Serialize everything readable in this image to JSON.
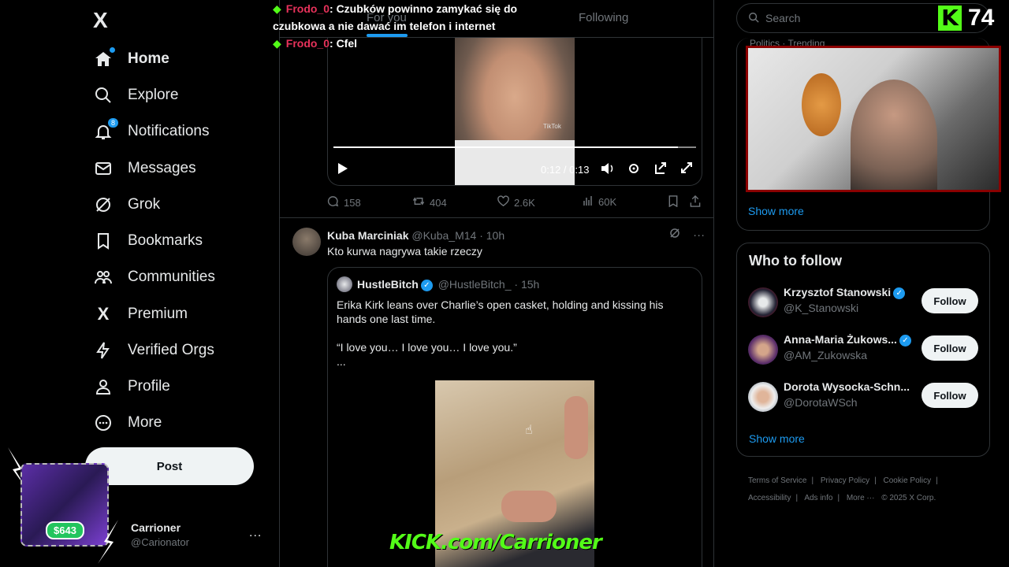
{
  "sidebar": {
    "logo": "X",
    "items": [
      {
        "label": "Home",
        "icon": "home-icon"
      },
      {
        "label": "Explore",
        "icon": "search-icon"
      },
      {
        "label": "Notifications",
        "icon": "bell-icon",
        "badge": "8"
      },
      {
        "label": "Messages",
        "icon": "mail-icon"
      },
      {
        "label": "Grok",
        "icon": "grok-icon"
      },
      {
        "label": "Bookmarks",
        "icon": "bookmark-icon"
      },
      {
        "label": "Communities",
        "icon": "people-icon"
      },
      {
        "label": "Premium",
        "icon": "x-icon"
      },
      {
        "label": "Verified Orgs",
        "icon": "lightning-icon"
      },
      {
        "label": "Profile",
        "icon": "person-icon"
      },
      {
        "label": "More",
        "icon": "more-circle-icon"
      }
    ],
    "post_label": "Post",
    "account": {
      "name": "Carrioner",
      "handle": "@Carionator",
      "more": "..."
    }
  },
  "overlay": {
    "donation": "$643",
    "chat": [
      {
        "user": "Frodo_0",
        "text": ": Czubków powinno zamykać się do czubkowa a nie dawać im telefon i internet"
      },
      {
        "user": "Frodo_0",
        "text": ": Cfel"
      }
    ],
    "kick_url": "KICK.com/Carrioner",
    "kick_logo": "K",
    "viewer_count": "74"
  },
  "tabs": [
    {
      "label": "For you"
    },
    {
      "label": "Following"
    }
  ],
  "tweet1": {
    "video_time": "0:12 / 0:13",
    "video_watermark": "TikTok",
    "progress": 0.95,
    "stats": {
      "replies": "158",
      "reposts": "404",
      "likes": "2.6K",
      "views": "60K"
    }
  },
  "tweet2": {
    "author": "Kuba Marciniak",
    "handle": "@Kuba_M14",
    "time": "· 10h",
    "text": "Kto kurwa nagrywa takie rzeczy",
    "more": "···",
    "quote": {
      "author": "HustleBitch",
      "handle": "@HustleBitch_",
      "time": "· 15h",
      "line1": "Erika Kirk leans over Charlie’s open casket, holding and kissing his hands one last time.",
      "line2": "“I love you… I love you… I love you.”",
      "line3": "..."
    }
  },
  "right": {
    "search_placeholder": "Search",
    "trending_label": "Politics · Trending",
    "show_more": "Show more",
    "who_to_follow": "Who to follow",
    "follow_label": "Follow",
    "suggestions": [
      {
        "name": "Krzysztof Stanowski",
        "handle": "@K_Stanowski",
        "verified": true
      },
      {
        "name": "Anna-Maria Żukows...",
        "handle": "@AM_Zukowska",
        "verified": true
      },
      {
        "name": "Dorota Wysocka-Schn...",
        "handle": "@DorotaWSch",
        "verified": false
      }
    ],
    "footer": [
      "Terms of Service",
      "|",
      "Privacy Policy",
      "|",
      "Cookie Policy",
      "|",
      "Accessibility",
      "|",
      "Ads info",
      "|",
      "More ···",
      "© 2025 X Corp."
    ]
  }
}
